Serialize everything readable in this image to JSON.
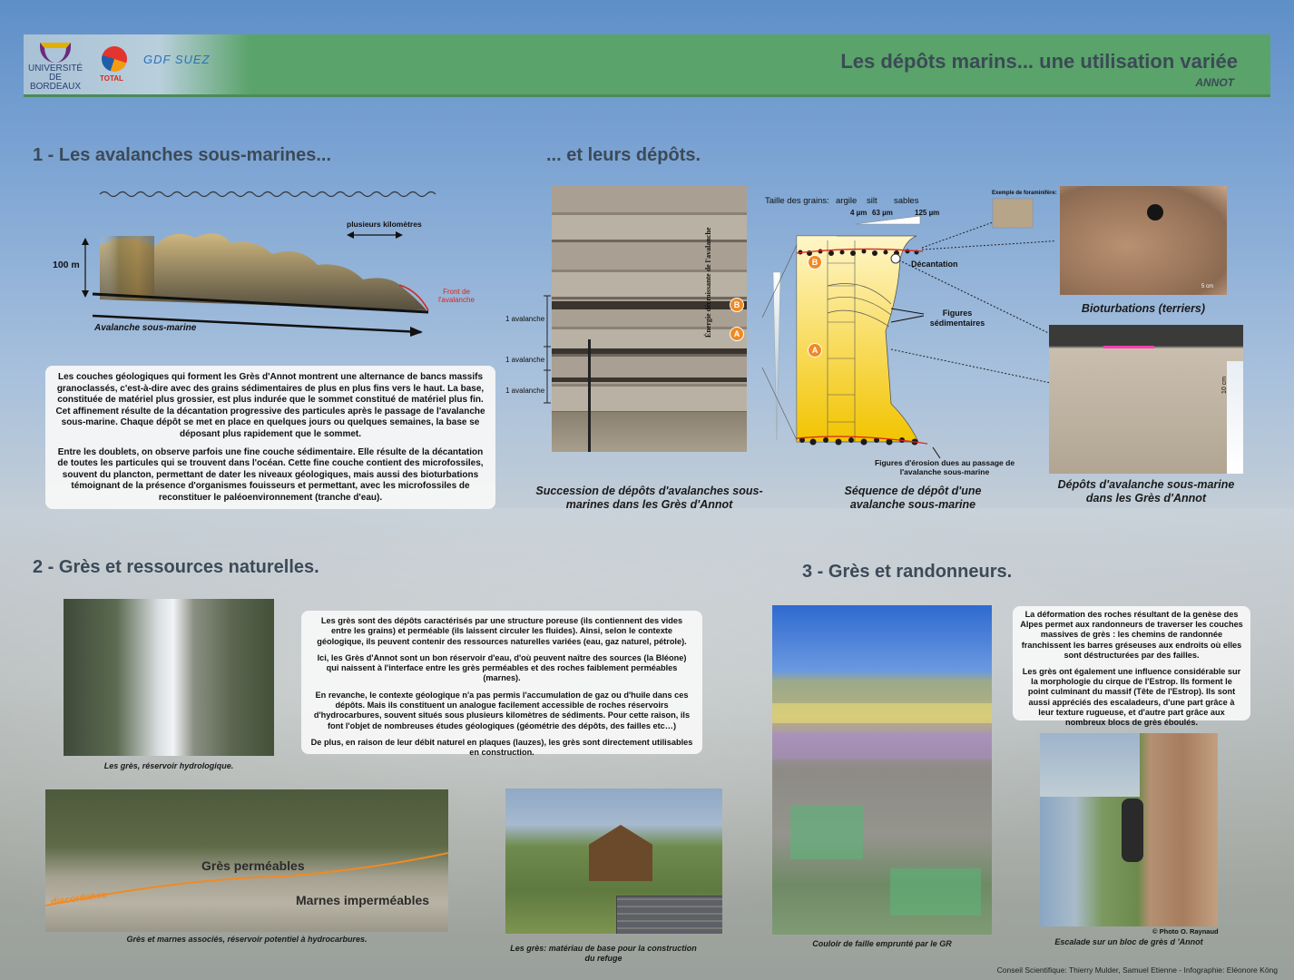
{
  "header": {
    "logo_ub": "UNIVERSITÉ DE BORDEAUX",
    "logo_total": "TOTAL",
    "logo_gdf": "GDF SUEZ",
    "title": "Les dépôts marins... une utilisation variée",
    "subtitle": "ANNOT"
  },
  "section1": {
    "title": "1 - Les avalanches sous-marines...",
    "diagram": {
      "height_label": "100 m",
      "width_label": "plusieurs kilomètres",
      "front_label": "Front de l'avalanche",
      "caption": "Avalanche sous-marine"
    },
    "paragraphs": [
      "Les couches géologiques qui forment les Grès d'Annot montrent une alternance de bancs massifs granoclassés, c'est-à-dire avec des grains sédimentaires de plus en plus fins vers le haut. La base, constituée de matériel plus grossier, est plus indurée que le sommet constitué de matériel plus fin. Cet affinement résulte de la décantation progressive des particules après le passage de l'avalanche sous-marine. Chaque dépôt se met en place en quelques jours ou quelques semaines, la base se déposant plus rapidement que le sommet.",
      "Entre les doublets, on observe parfois une fine couche sédimentaire. Elle résulte de la décantation de toutes les particules qui se trouvent dans l'océan. Cette fine couche contient des microfossiles, souvent du plancton, permettant de dater les niveaux géologiques, mais aussi des bioturbations témoignant de la présence d'organismes fouisseurs et permettant, avec les microfossiles de reconstituer le paléoenvironnement (tranche d'eau)."
    ]
  },
  "section1b": {
    "title": "... et leurs dépôts.",
    "photo_labels": {
      "layer": "1 avalanche",
      "badge_b": "B",
      "badge_a": "A"
    },
    "photo_caption": "Succession de dépôts d'avalanches sous-marines dans les Grès d'Annot",
    "sequence": {
      "grain_title": "Taille des grains:",
      "grain_classes": [
        "argile",
        "silt",
        "sables"
      ],
      "grain_sizes": [
        "4 µm",
        "63 µm",
        "125 µm"
      ],
      "energy_label": "Énergie décroissante de l'avalanche",
      "foram_label": "Exemple de foraminifère:",
      "decantation": "Décantation",
      "figures": "Figures sédimentaires",
      "erosion": "Figures d'érosion dues au passage de l'avalanche sous-marine",
      "caption": "Séquence de dépôt d'une avalanche sous-marine"
    },
    "bioturbation_caption": "Bioturbations (terriers)",
    "bioturbation_scale": "5 cm",
    "deposit_caption": "Dépôts d'avalanche sous-marine dans les Grès d'Annot",
    "deposit_scale": "10 cm"
  },
  "section2": {
    "title": "2 - Grès et ressources naturelles.",
    "paragraphs": [
      "Les grès sont des dépôts caractérisés par une structure poreuse (ils contiennent des vides entre les grains) et perméable (ils laissent circuler les fluides). Ainsi, selon le contexte géologique, ils peuvent contenir des ressources naturelles variées (eau, gaz naturel, pétrole).",
      "Ici, les Grès d'Annot sont un bon réservoir d'eau, d'où peuvent naître des sources (la Bléone) qui naissent à l'interface entre les grès perméables et des roches faiblement perméables (marnes).",
      "En revanche, le contexte géologique n'a pas permis l'accumulation de gaz ou d'huile dans ces dépôts. Mais ils constituent un analogue facilement accessible de roches réservoirs d'hydrocarbures, souvent situés sous plusieurs kilomètres de sédiments. Pour cette raison, ils font l'objet de nombreuses études géologiques (géométrie des dépôts, des failles etc…)",
      "De plus, en raison de leur débit naturel en plaques (lauzes), les grès sont directement utilisables en construction."
    ],
    "waterfall_caption": "Les grès, réservoir hydrologique.",
    "landscape": {
      "gres": "Grès perméables",
      "marnes": "Marnes imperméables",
      "discordance": "discordance",
      "caption": "Grès et marnes associés, réservoir potentiel à hydrocarbures."
    },
    "refuge_caption": "Les grès: matériau de base pour la construction du refuge"
  },
  "section3": {
    "title": "3 - Grès et randonneurs.",
    "paragraphs": [
      "La déformation des roches résultant de la genèse des Alpes permet aux randonneurs de traverser les couches massives de grès : les chemins de randonnée franchissent les barres gréseuses aux endroits où elles sont déstructurées par des failles.",
      "Les grès ont également une influence considérable sur la morphologie du cirque de l'Estrop. Ils forment le point culminant du massif (Tête de l'Estrop). Ils sont aussi appréciés des escaladeurs, d'une part grâce à leur texture rugueuse, et d'autre part grâce aux nombreux blocs de grès éboulés."
    ],
    "couloir_caption": "Couloir de faille emprunté par le GR",
    "photo_credit": "© Photo O. Raynaud",
    "escalade_caption": "Escalade sur un bloc de grès d 'Annot"
  },
  "credits": "Conseil Scientifique: Thierry Mulder, Samuel Etienne - Infographie: Eléonore Köng"
}
